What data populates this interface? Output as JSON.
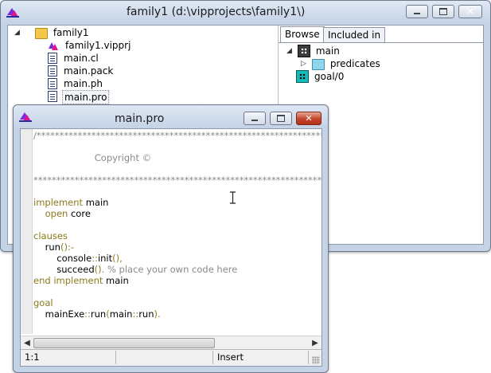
{
  "project_window": {
    "title": "family1 (d:\\vipprojects\\family1\\)",
    "tree": {
      "root": "family1",
      "items": [
        "family1.vipprj",
        "main.cl",
        "main.pack",
        "main.ph",
        "main.pro"
      ],
      "selected": "main.pro"
    },
    "browse": {
      "tabs": [
        "Browse",
        "Included in"
      ],
      "active_tab": "Browse",
      "items": [
        {
          "label": "main",
          "icon": "class-icon"
        },
        {
          "label": "predicates",
          "icon": "folder-icon"
        },
        {
          "label": "goal/0",
          "icon": "predicate-icon"
        }
      ]
    }
  },
  "editor_window": {
    "title": "main.pro",
    "code_lines": [
      "/*******************************************************************",
      "",
      "                     Copyright ©",
      "",
      "*******************************************************************/",
      "",
      "implement main",
      "    open core",
      "",
      "clauses",
      "    run():-",
      "        console::init(),",
      "        succeed(). % place your own code here",
      "end implement main",
      "",
      "goal",
      "    mainExe::run(main::run)."
    ],
    "status": {
      "position": "1:1",
      "mode": "Insert"
    }
  },
  "colors": {
    "keyword": "#8b7b1b",
    "comment": "#8a8a8a",
    "close_button": "#c4462c"
  }
}
